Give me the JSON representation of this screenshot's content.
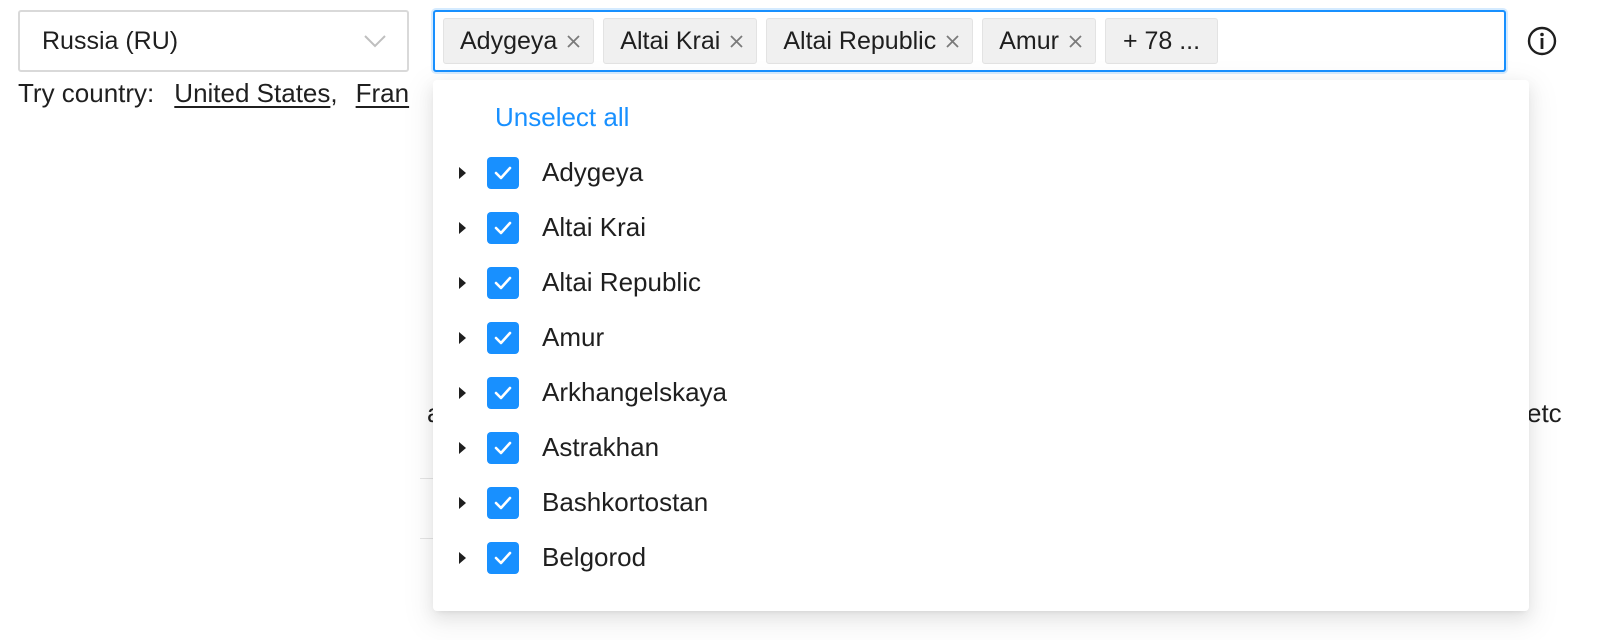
{
  "country_select": {
    "value": "Russia (RU)"
  },
  "try_country": {
    "label": "Try country:",
    "links": [
      "United States",
      "Fran"
    ],
    "separator": ","
  },
  "region_select": {
    "tags": [
      "Adygeya",
      "Altai Krai",
      "Altai Republic",
      "Amur"
    ],
    "more_label": "+ 78 ..."
  },
  "background": {
    "left_fragment": "a",
    "right_fragment": "etc"
  },
  "dropdown": {
    "unselect_all": "Unselect all",
    "items": [
      {
        "label": "Adygeya",
        "checked": true
      },
      {
        "label": "Altai Krai",
        "checked": true
      },
      {
        "label": "Altai Republic",
        "checked": true
      },
      {
        "label": "Amur",
        "checked": true
      },
      {
        "label": "Arkhangelskaya",
        "checked": true
      },
      {
        "label": "Astrakhan",
        "checked": true
      },
      {
        "label": "Bashkortostan",
        "checked": true
      },
      {
        "label": "Belgorod",
        "checked": true
      }
    ]
  },
  "colors": {
    "accent": "#1890ff",
    "text": "#1f1f1f",
    "tag_bg": "#f0f0f0"
  },
  "icons": [
    "chevron-down-icon",
    "close-icon",
    "info-icon",
    "caret-right-icon",
    "check-icon"
  ]
}
